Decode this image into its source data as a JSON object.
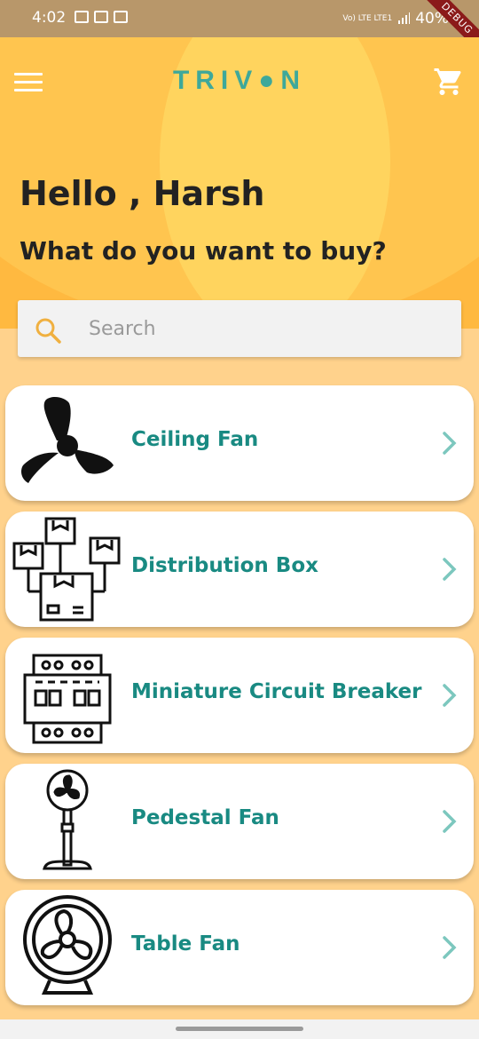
{
  "status_bar": {
    "time": "4:02",
    "network": "Vo) LTE LTE1",
    "battery": "40%",
    "debug_banner": "DEBUG"
  },
  "app_bar": {
    "logo": "TRIV●N",
    "menu_icon": "hamburger-menu-icon",
    "cart_icon": "shopping-cart-icon"
  },
  "hero": {
    "greeting": "Hello , Harsh",
    "question": "What do you want to buy?"
  },
  "search": {
    "placeholder": "Search",
    "icon": "search-icon"
  },
  "categories": [
    {
      "label": "Ceiling Fan",
      "icon": "ceiling-fan-icon"
    },
    {
      "label": "Distribution Box",
      "icon": "distribution-box-icon"
    },
    {
      "label": "Miniature Circuit Breaker",
      "icon": "circuit-breaker-icon"
    },
    {
      "label": "Pedestal Fan",
      "icon": "pedestal-fan-icon"
    },
    {
      "label": "Table Fan",
      "icon": "table-fan-icon"
    }
  ],
  "colors": {
    "header_bg": "#FFB940",
    "accent_teal": "#198A82",
    "logo_teal": "#3EA89A",
    "page_bg": "#FFD28C"
  }
}
